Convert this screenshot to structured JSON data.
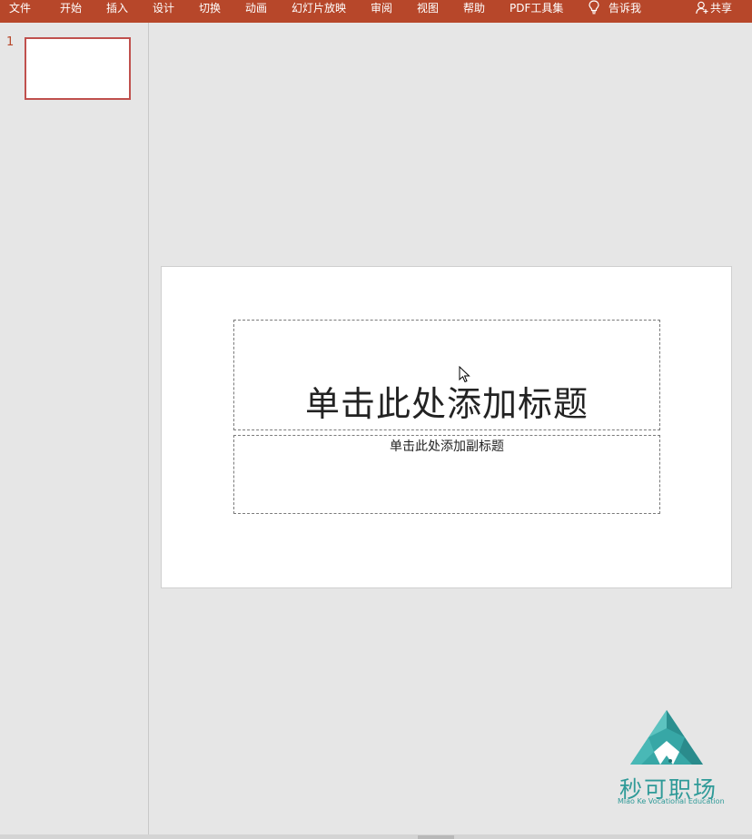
{
  "ribbon": {
    "tabs": [
      "文件",
      "开始",
      "插入",
      "设计",
      "切换",
      "动画",
      "幻灯片放映",
      "审阅",
      "视图",
      "帮助",
      "PDF工具集"
    ],
    "tell_me": "告诉我",
    "share": "共享"
  },
  "thumbnails": [
    {
      "number": "1"
    }
  ],
  "slide": {
    "title_placeholder": "单击此处添加标题",
    "subtitle_placeholder": "单击此处添加副标题"
  },
  "watermark": {
    "name": "秒可职场",
    "tagline": "Miao Ke Vocational Education"
  },
  "colors": {
    "ribbon": "#b7472a",
    "selection_border": "#c0504d",
    "workspace": "#e6e6e6",
    "logo": "#2f9a98"
  }
}
